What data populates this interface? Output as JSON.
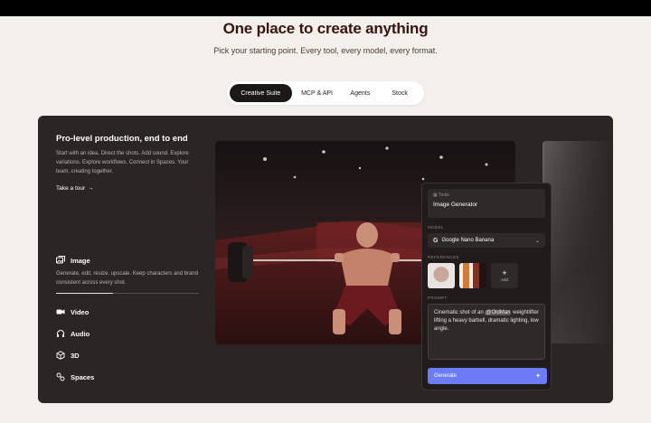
{
  "hero": {
    "title": "One place to create anything",
    "subtitle": "Pick your starting point. Every tool, every model, every format."
  },
  "tabs": [
    {
      "label": "Creative Suite",
      "active": true
    },
    {
      "label": "MCP & API",
      "active": false
    },
    {
      "label": "Agents",
      "active": false
    },
    {
      "label": "Stock",
      "active": false
    }
  ],
  "intro": {
    "title": "Pro-level production, end to end",
    "description": "Start with an idea. Direct the shots. Add sound. Explore variations. Explore workflows. Connect in Spaces. Your team, creating together.",
    "tour_label": "Take a tour",
    "tour_arrow": "→"
  },
  "features": {
    "image": {
      "label": "Image",
      "icon": "image-stack-icon",
      "description": "Generate, edit, resize, upscale. Keep characters and brand consistent across every shot.",
      "progress": 0.4
    },
    "video": {
      "label": "Video",
      "icon": "video-camera-icon"
    },
    "audio": {
      "label": "Audio",
      "icon": "headphones-icon"
    },
    "three_d": {
      "label": "3D",
      "icon": "cube-icon"
    },
    "spaces": {
      "label": "Spaces",
      "icon": "spaces-icon"
    }
  },
  "tool_panel": {
    "kicker": "Tools",
    "name": "Image Generator",
    "model_label": "MODEL",
    "model_logo": "G",
    "model_value": "Google Nano Banana",
    "references_label": "REFERENCES",
    "add_label": "Add",
    "add_glyph": "+",
    "prompt_label": "PROMPT",
    "prompt_before": "Cinematic shot of an ",
    "prompt_mention": "@OldMan",
    "prompt_after": " weightlifter lifting a heavy barbell, dramatic lighting, low angle.",
    "generate_label": "Generate"
  },
  "colors": {
    "background": "#f3f0ec",
    "title": "#3a1410",
    "panel": "#2b2625",
    "generate_button": "#6b7cf5"
  }
}
